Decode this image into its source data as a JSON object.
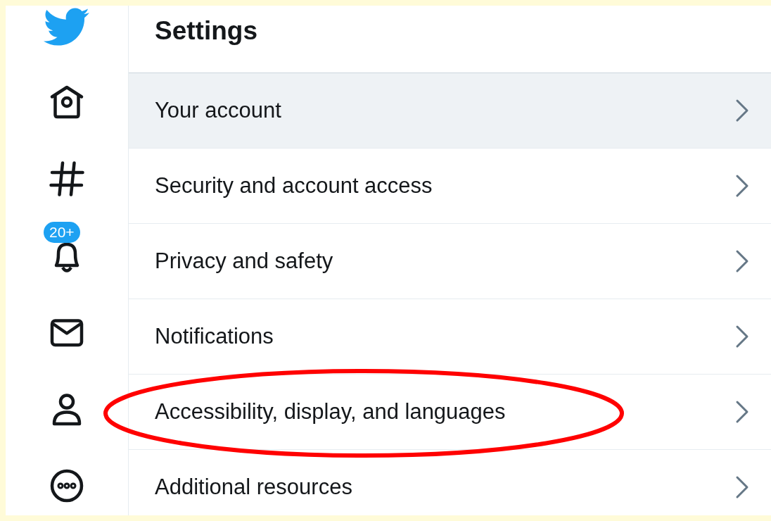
{
  "sidebar": {
    "items": [
      {
        "kind": "home",
        "selected": false
      },
      {
        "kind": "explore",
        "selected": false
      },
      {
        "kind": "notifications",
        "selected": false,
        "badge": "20+"
      },
      {
        "kind": "messages",
        "selected": false
      },
      {
        "kind": "profile",
        "selected": false
      },
      {
        "kind": "more",
        "selected": false
      }
    ]
  },
  "header": {
    "title": "Settings"
  },
  "settings": {
    "items": [
      {
        "label": "Your account",
        "selected": true
      },
      {
        "label": "Security and account access",
        "selected": false
      },
      {
        "label": "Privacy and safety",
        "selected": false
      },
      {
        "label": "Notifications",
        "selected": false
      },
      {
        "label": "Accessibility, display, and languages",
        "selected": false,
        "circled": true
      },
      {
        "label": "Additional resources",
        "selected": false
      }
    ]
  }
}
